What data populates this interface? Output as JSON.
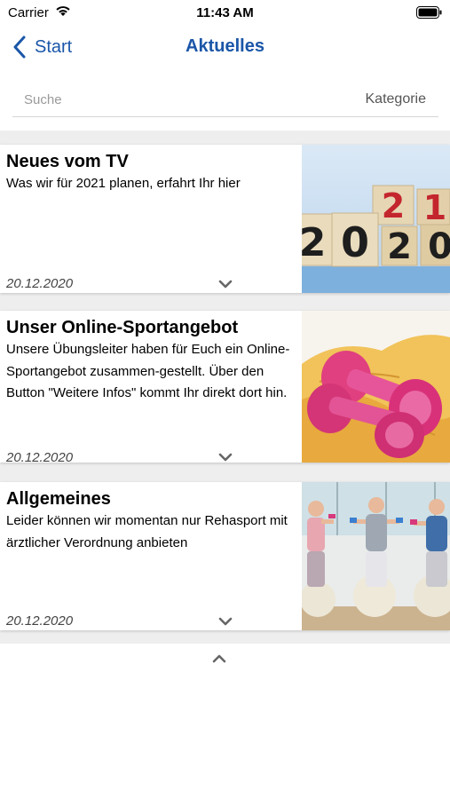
{
  "status_bar": {
    "carrier": "Carrier",
    "time": "11:43 AM",
    "wifi_icon": "wifi-icon",
    "battery_icon": "battery-icon"
  },
  "nav": {
    "back_label": "Start",
    "title": "Aktuelles",
    "back_icon": "chevron-left-icon",
    "accent_color": "#1a56a8"
  },
  "search": {
    "placeholder": "Suche",
    "category_label": "Kategorie"
  },
  "news": [
    {
      "title": "Neues vom TV",
      "text": "Was wir für 2021 planen, erfahrt Ihr hier",
      "date": "20.12.2020",
      "image": "wooden-blocks-2020-2021-image"
    },
    {
      "title": "Unser Online-Sportangebot",
      "text": "Unsere Übungsleiter haben für Euch ein Online-Sportangebot zusammen-gestellt. Über den Button \"Weitere Infos\" kommt Ihr direkt dort hin.",
      "date": "20.12.2020",
      "image": "pink-dumbbells-image"
    },
    {
      "title": "Allgemeines",
      "text": "Leider können wir momentan nur Rehasport mit ärztlicher Verordnung anbieten",
      "date": "20.12.2020",
      "image": "fitness-class-image"
    }
  ],
  "image_digits": {
    "top": [
      "2",
      "1"
    ],
    "bottom": [
      "2",
      "0",
      "2",
      "0"
    ]
  }
}
